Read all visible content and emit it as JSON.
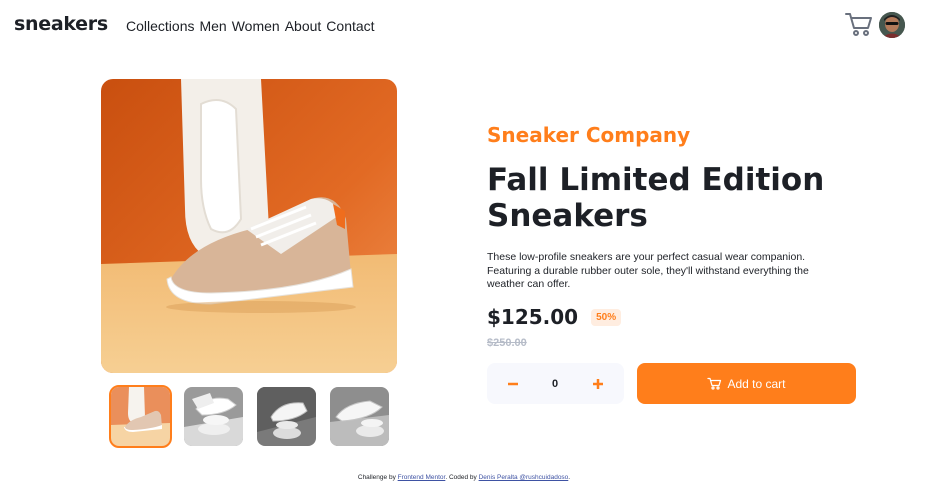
{
  "brand": {
    "logo": "sneakers"
  },
  "nav": {
    "items": [
      "Collections",
      "Men",
      "Women",
      "About",
      "Contact"
    ]
  },
  "header_icons": {
    "cart": "cart-icon",
    "avatar": "avatar"
  },
  "product": {
    "company": "Sneaker Company",
    "title": "Fall Limited Edition Sneakers",
    "description": "These low-profile sneakers are your perfect casual wear companion. Featuring a durable rubber outer sole, they'll withstand everything the weather can offer.",
    "price": "$125.00",
    "discount": "50%",
    "old_price": "$250.00",
    "quantity": "0",
    "add_to_cart": "Add to cart"
  },
  "footer": {
    "prefix": "Challenge by",
    "link1": "Frontend Mentor",
    "middle": ". Coded by",
    "link2": "Denis Peralta @rushcuidadoso",
    "suffix": "."
  },
  "colors": {
    "accent": "#ff7e1b",
    "accent_pale": "#ffede0",
    "text": "#1d2026",
    "muted": "#b6bcc8"
  }
}
